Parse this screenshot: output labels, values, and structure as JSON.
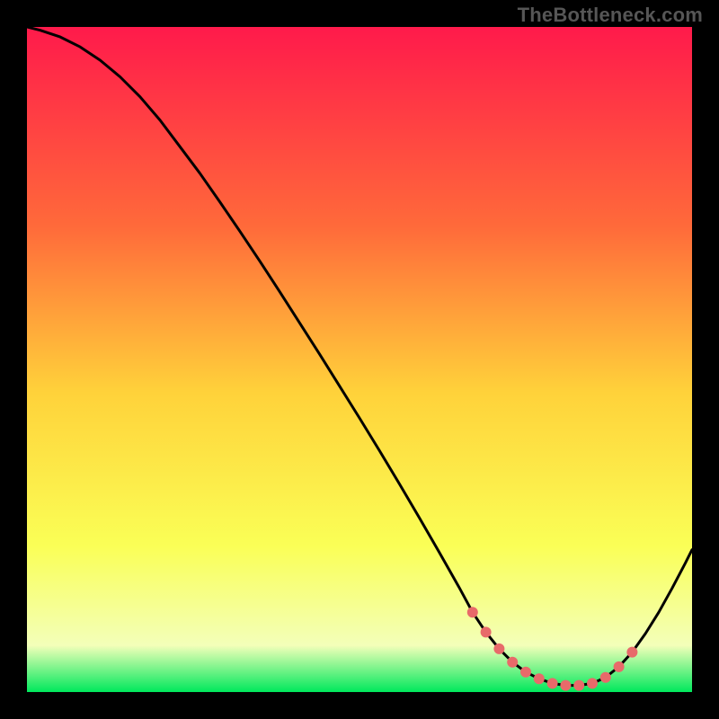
{
  "watermark": "TheBottleneck.com",
  "colors": {
    "gradient_top": "#ff1a4b",
    "gradient_mid_upper": "#ff6a3a",
    "gradient_mid": "#ffd23a",
    "gradient_mid_lower": "#faff56",
    "gradient_lower": "#f3ffb9",
    "gradient_bottom": "#00e85c",
    "curve": "#000000",
    "dots": "#e86a6a"
  },
  "chart_data": {
    "type": "line",
    "title": "",
    "xlabel": "",
    "ylabel": "",
    "xlim": [
      0,
      100
    ],
    "ylim": [
      0,
      100
    ],
    "grid": false,
    "curve": {
      "name": "bottleneck-curve",
      "x": [
        0,
        2,
        5,
        8,
        11,
        14,
        17,
        20,
        23,
        26,
        29,
        32,
        35,
        38,
        41,
        44,
        47,
        50,
        53,
        56,
        59,
        62,
        65,
        67,
        69,
        71,
        73,
        75,
        77,
        79,
        81,
        83,
        85,
        87,
        89,
        91,
        93,
        95,
        97,
        99,
        100
      ],
      "y": [
        100,
        99.5,
        98.5,
        97,
        95,
        92.5,
        89.5,
        86,
        82,
        78,
        73.7,
        69.3,
        64.8,
        60.2,
        55.5,
        50.8,
        46,
        41.2,
        36.3,
        31.3,
        26.2,
        21,
        15.7,
        12,
        9,
        6.5,
        4.5,
        3,
        2,
        1.3,
        1,
        1,
        1.3,
        2.2,
        3.8,
        6,
        8.8,
        12,
        15.6,
        19.4,
        21.4
      ]
    },
    "dots": {
      "name": "highlight-dots",
      "x": [
        67,
        69,
        71,
        73,
        75,
        77,
        79,
        81,
        83,
        85,
        87,
        89,
        91
      ],
      "y": [
        12,
        9,
        6.5,
        4.5,
        3,
        2,
        1.3,
        1,
        1,
        1.3,
        2.2,
        3.8,
        6
      ]
    }
  }
}
